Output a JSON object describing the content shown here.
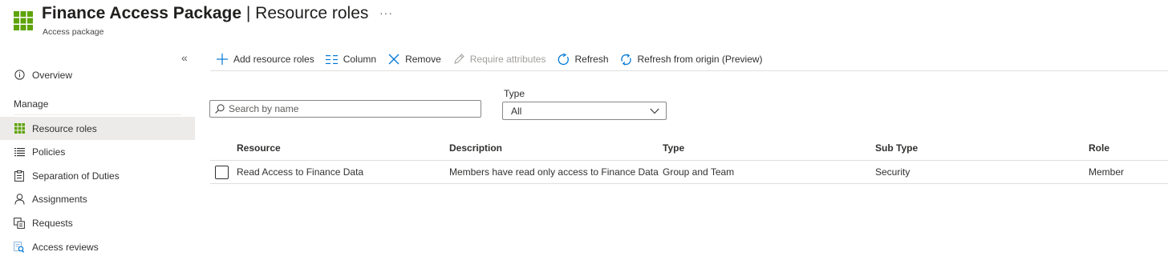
{
  "header": {
    "title_main": "Finance Access Package",
    "title_separator": " | ",
    "title_section": "Resource roles",
    "subtitle": "Access package",
    "more_glyph": "···",
    "app_icon": "grid-icon",
    "accent_color": "#5ea30a"
  },
  "sidebar": {
    "collapse_glyph": "«",
    "section_label": "Manage",
    "items": [
      {
        "label": "Overview",
        "icon": "info-icon"
      },
      {
        "label": "Resource roles",
        "icon": "grid-icon",
        "selected": true
      },
      {
        "label": "Policies",
        "icon": "list-icon"
      },
      {
        "label": "Separation of Duties",
        "icon": "clipboard-icon"
      },
      {
        "label": "Assignments",
        "icon": "person-icon"
      },
      {
        "label": "Requests",
        "icon": "requests-icon"
      },
      {
        "label": "Access reviews",
        "icon": "review-icon"
      }
    ]
  },
  "toolbar": {
    "add": "Add resource roles",
    "column": "Column",
    "remove": "Remove",
    "require": "Require attributes",
    "refresh": "Refresh",
    "refresh_origin": "Refresh from origin (Preview)",
    "icon_color": "#0078d4"
  },
  "filters": {
    "search_placeholder": "Search by name",
    "type_label": "Type",
    "type_value": "All"
  },
  "table": {
    "columns": [
      "Resource",
      "Description",
      "Type",
      "Sub Type",
      "Role"
    ],
    "rows": [
      {
        "resource": "Read Access to Finance Data",
        "description": "Members have read only access to Finance Data",
        "type": "Group and Team",
        "sub_type": "Security",
        "role": "Member"
      }
    ]
  }
}
